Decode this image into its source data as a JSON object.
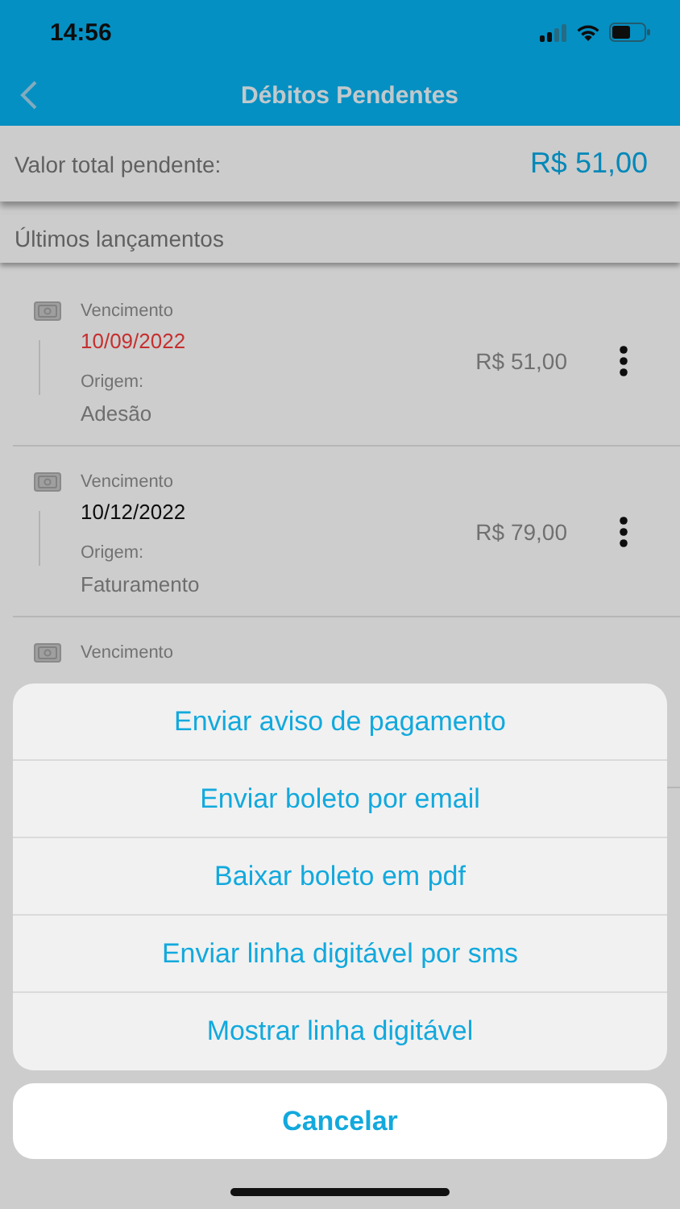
{
  "status_bar": {
    "time": "14:56"
  },
  "header": {
    "title": "Débitos Pendentes"
  },
  "total": {
    "label": "Valor total pendente:",
    "value": "R$ 51,00"
  },
  "section": {
    "title": "Últimos lançamentos"
  },
  "entries": [
    {
      "due_label": "Vencimento",
      "due_date": "10/09/2022",
      "overdue": true,
      "origin_label": "Origem:",
      "origin": "Adesão",
      "amount": "R$ 51,00"
    },
    {
      "due_label": "Vencimento",
      "due_date": "10/12/2022",
      "overdue": false,
      "origin_label": "Origem:",
      "origin": "Faturamento",
      "amount": "R$ 79,00"
    },
    {
      "due_label": "Vencimento"
    }
  ],
  "action_sheet": {
    "actions": [
      "Enviar aviso de pagamento",
      "Enviar boleto por email",
      "Baixar boleto em pdf",
      "Enviar linha digitável por sms",
      "Mostrar linha digitável"
    ],
    "cancel": "Cancelar"
  }
}
